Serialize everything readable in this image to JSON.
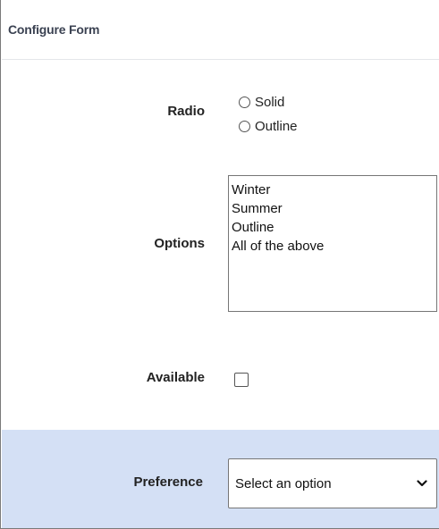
{
  "header": {
    "title": "Configure Form"
  },
  "radio": {
    "label": "Radio",
    "options": [
      "Solid",
      "Outline"
    ]
  },
  "options": {
    "label": "Options",
    "items": [
      "Winter",
      "Summer",
      "Outline",
      "All of the above"
    ]
  },
  "available": {
    "label": "Available",
    "checked": false
  },
  "preference": {
    "label": "Preference",
    "selected": "Select an option"
  },
  "colors": {
    "band": "#d4e0f5",
    "border": "#767676"
  }
}
